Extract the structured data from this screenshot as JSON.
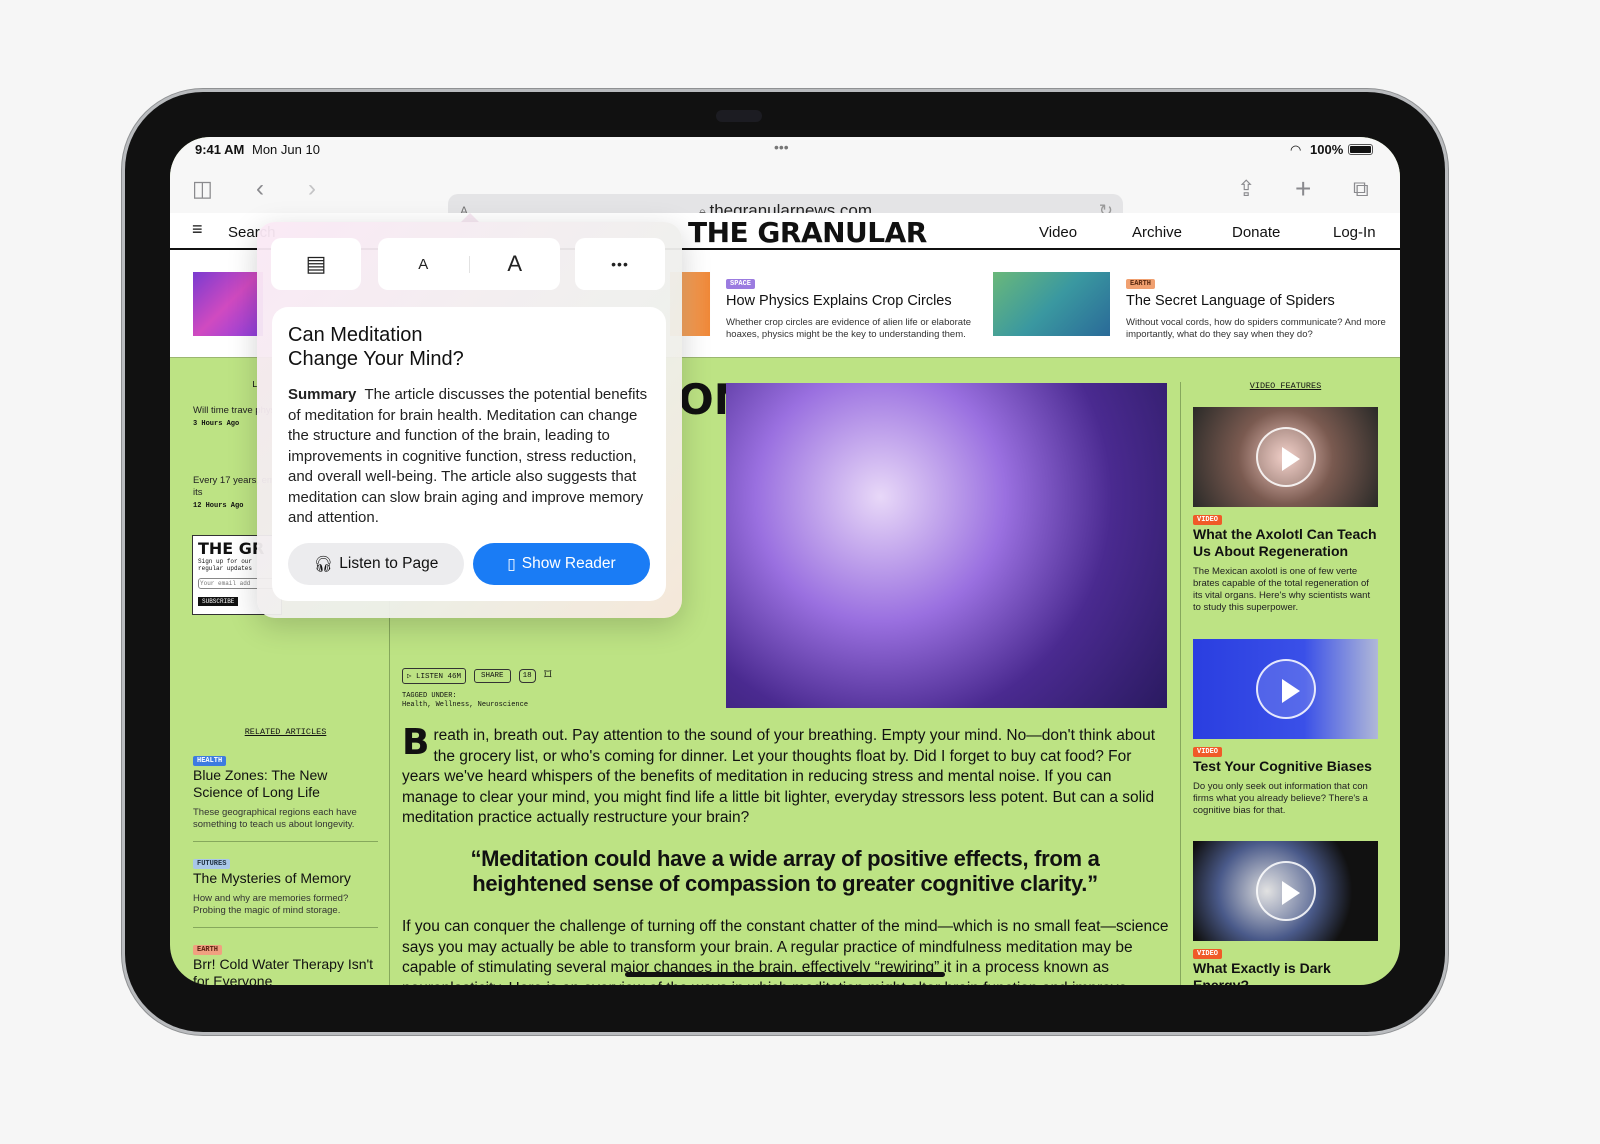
{
  "status": {
    "time": "9:41 AM",
    "date": "Mon Jun 10",
    "battery": "100%"
  },
  "browser": {
    "url": "thegranularnews.com"
  },
  "site": {
    "logo": "THE GRANULAR",
    "search": "Search",
    "nav": [
      "Video",
      "Archive",
      "Donate",
      "Log-In"
    ]
  },
  "top_cards": [
    {
      "tag": "SPACE",
      "tag_color": "#9b7be0",
      "title": "How Physics Explains Crop Circles",
      "desc": "Whether crop circles are evidence of alien life or elaborate hoaxes, physics might be the key to understanding them."
    },
    {
      "tag": "EARTH",
      "tag_color": "#f0a070",
      "title": "The Secret Language of Spiders",
      "desc": "Without vocal cords, how do spiders communicate? And more importantly, what do they say when they do?"
    }
  ],
  "left_col": {
    "heading": "L",
    "items": [
      {
        "text": "Will time trave physicists expl we could move",
        "time": "3 Hours Ago"
      },
      {
        "text": "Every 17 years, emerge from tl apocalypse, its",
        "time": "12 Hours Ago"
      }
    ],
    "newsletter": {
      "logo": "THE GR",
      "text": "Sign up for our regular updates",
      "placeholder": "Your email add",
      "button": "SUBSCRIBE"
    }
  },
  "related": {
    "heading": "RELATED ARTICLES",
    "items": [
      {
        "tag": "HEALTH",
        "tag_color": "#3d7be0",
        "title": "Blue Zones: The New Science of Long Life",
        "desc": "These geographical regions each have something to teach us about longevity."
      },
      {
        "tag": "FUTURES",
        "tag_color": "#a9c7e8",
        "title": "The Mysteries of Memory",
        "desc": "How and why are memories formed? Probing the magic of mind storage."
      },
      {
        "tag": "EARTH",
        "tag_color": "#f0a080",
        "title": "Brr! Cold Water Therapy Isn't for Everyone",
        "desc": ""
      }
    ]
  },
  "article": {
    "title_fragment": "ON",
    "actions": {
      "listen": "LISTEN 46M",
      "share": "SHARE",
      "comments": "18"
    },
    "tagged_label": "TAGGED UNDER:",
    "tags": "Health, Wellness, Neuroscience",
    "dropcap": "B",
    "para1": "reath in, breath out. Pay attention to the sound of your breathing. Empty your mind. No—don't think about the grocery list, or who's coming for dinner. Let your thoughts float by. Did I forget to buy cat food? For years we've heard whispers of the benefits of meditation in reducing stress and mental noise. If you can manage to clear your mind, you might find life a little bit lighter, everyday stressors less potent. But can a solid meditation practice actually restructure your brain?",
    "quote": "“Meditation could have a wide array of positive effects, from a heightened sense of compassion to greater cognitive clarity.”",
    "para2": "If you can conquer the challenge of turning off the constant chatter of the mind—which is no small feat—science says you may actually be able to transform your brain. A regular practice of mindfulness meditation may be capable of stimulating several major changes in the brain, effectively “rewiring” it in a process known as neuroplasticity. Here is an overview of the ways in which meditation might alter brain function and improve cognitive health, and improve"
  },
  "video": {
    "heading": "VIDEO FEATURES",
    "items": [
      {
        "tag": "VIDEO",
        "title": "What the Axolotl Can Teach Us About Regeneration",
        "desc": "The Mexican axolotl is one of few verte brates capable of the total regeneration of its vital organs. Here's why scientists want to study this superpower."
      },
      {
        "tag": "VIDEO",
        "title": "Test Your Cognitive Biases",
        "desc": "Do you only seek out information that con firms what you already believe? There's a cognitive bias for that."
      },
      {
        "tag": "VIDEO",
        "title": "What Exactly is Dark Energy?",
        "desc": ""
      }
    ]
  },
  "popover": {
    "small_a": "A",
    "large_a": "A",
    "more": "•••",
    "title": "Can Meditation Change Your Mind?",
    "summary_label": "Summary",
    "summary": "The article discusses the potential benefits of meditation for brain health. Meditation can change the structure and function of the brain, leading to improvements in cognitive function, stress reduction, and overall well-being. The article also suggests that meditation can slow brain aging and improve memory and attention.",
    "listen_btn": "Listen to Page",
    "reader_btn": "Show Reader",
    "accent": "#1a7cf5"
  }
}
